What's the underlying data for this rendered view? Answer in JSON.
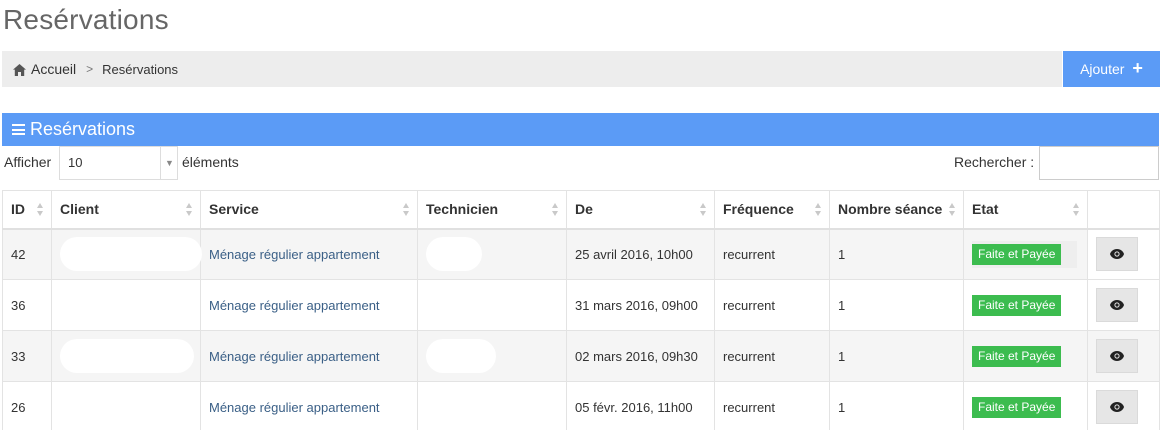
{
  "page": {
    "title": "Resérvations"
  },
  "breadcrumb": {
    "home": "Accueil",
    "current": "Resérvations"
  },
  "toolbar": {
    "add_label": "Ajouter"
  },
  "panel": {
    "title": "Resérvations"
  },
  "controls": {
    "show_label": "Afficher",
    "page_size": "10",
    "elements_label": "éléments",
    "search_label": "Rechercher :",
    "search_value": ""
  },
  "table": {
    "columns": [
      "ID",
      "Client",
      "Service",
      "Technicien",
      "De",
      "Fréquence",
      "Nombre séance",
      "Etat",
      ""
    ],
    "rows": [
      {
        "id": "42",
        "client": "",
        "service": "Ménage régulier appartement",
        "technician": "",
        "date": "25 avril 2016, 10h00",
        "frequency": "recurrent",
        "sessions": "1",
        "status": "Faite et Payée"
      },
      {
        "id": "36",
        "client": "",
        "service": "Ménage régulier appartement",
        "technician": "",
        "date": "31 mars 2016, 09h00",
        "frequency": "recurrent",
        "sessions": "1",
        "status": "Faite et Payée"
      },
      {
        "id": "33",
        "client": "",
        "service": "Ménage régulier appartement",
        "technician": "",
        "date": "02 mars 2016, 09h30",
        "frequency": "recurrent",
        "sessions": "1",
        "status": "Faite et Payée"
      },
      {
        "id": "26",
        "client": "",
        "service": "Ménage régulier appartement",
        "technician": "",
        "date": "05 févr. 2016, 11h00",
        "frequency": "recurrent",
        "sessions": "1",
        "status": "Faite et Payée"
      }
    ]
  },
  "icons": {
    "home": "home-icon",
    "chevron": "chevron-right-icon",
    "add": "plus-icon",
    "panel": "bars-icon",
    "caret": "caret-down-icon",
    "sort": "sort-icon",
    "view": "eye-icon"
  },
  "colors": {
    "accent": "#5b9bf6",
    "status_done": "#3cbc4f",
    "breadcrumb_bg": "#ededed",
    "row_stripe": "#f5f5f5"
  }
}
